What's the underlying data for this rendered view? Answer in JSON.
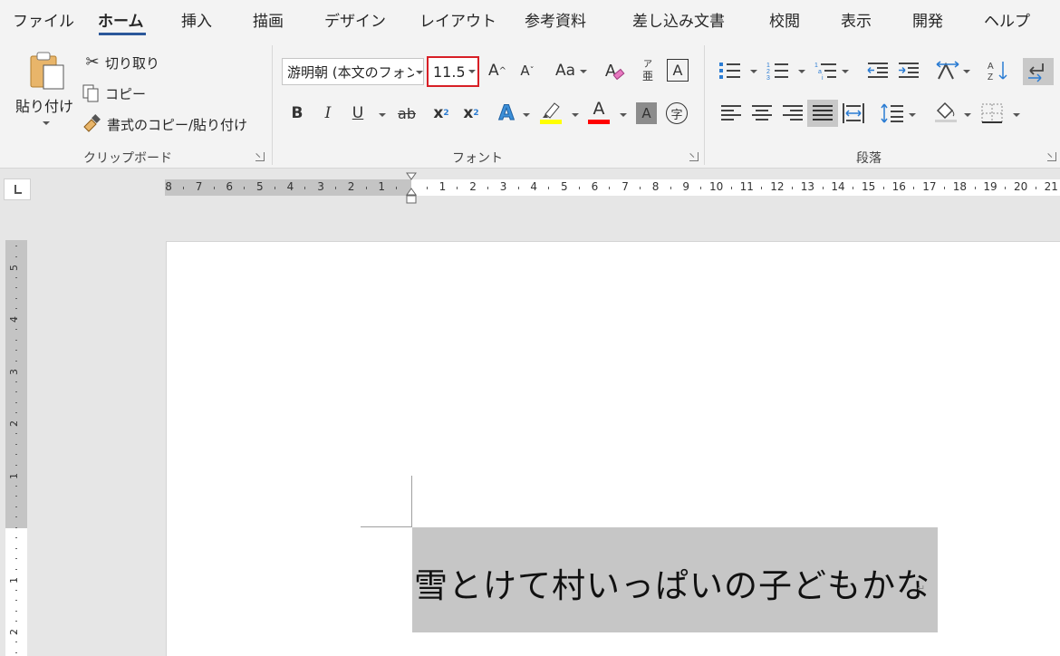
{
  "tabs": [
    {
      "label": "ファイル",
      "active": false
    },
    {
      "label": "ホーム",
      "active": true
    },
    {
      "label": "挿入",
      "active": false
    },
    {
      "label": "描画",
      "active": false
    },
    {
      "label": "デザイン",
      "active": false
    },
    {
      "label": "レイアウト",
      "active": false
    },
    {
      "label": "参考資料",
      "active": false
    },
    {
      "label": "差し込み文書",
      "active": false
    },
    {
      "label": "校閲",
      "active": false
    },
    {
      "label": "表示",
      "active": false
    },
    {
      "label": "開発",
      "active": false
    },
    {
      "label": "ヘルプ",
      "active": false
    }
  ],
  "clipboard": {
    "paste_label": "貼り付け",
    "cut_label": "切り取り",
    "copy_label": "コピー",
    "format_painter_label": "書式のコピー/貼り付け",
    "group_label": "クリップボード"
  },
  "font": {
    "name": "游明朝 (本文のフォント - 日本語)",
    "size": "11.5",
    "group_label": "フォント",
    "grow_icon_text": "A",
    "shrink_icon_text": "A",
    "case_icon_text": "Aa",
    "bold": "B",
    "italic": "I",
    "underline": "U",
    "strike": "ab",
    "subscript": "x",
    "subscript_mark": "2",
    "superscript": "x",
    "superscript_mark": "2",
    "text_effect": "A",
    "font_color_letter": "A",
    "char_shading_letter": "A",
    "enclose_char": "字",
    "phonetic_top": "ア",
    "phonetic_bottom": "亜",
    "char_border": "A",
    "highlight_color": "#ffff00",
    "font_color": "#ff0000"
  },
  "paragraph": {
    "group_label": "段落"
  },
  "ruler": {
    "horizontal_left_numbers": [
      "8",
      "7",
      "6",
      "5",
      "4",
      "3",
      "2",
      "1"
    ],
    "horizontal_right_numbers": [
      "1",
      "2",
      "3",
      "4",
      "5",
      "6",
      "7",
      "8",
      "9",
      "10",
      "11",
      "12",
      "13",
      "14",
      "15",
      "16",
      "17",
      "18",
      "19",
      "20",
      "21"
    ],
    "vertical_upper_numbers": [
      "5",
      "4",
      "3",
      "2",
      "1"
    ],
    "vertical_lower_numbers": [
      "1",
      "2"
    ]
  },
  "document": {
    "text": "雪とけて村いっぱいの子どもかな",
    "paragraph_mark": "↵"
  },
  "colors": {
    "accent": "#2b579a",
    "highlight_box": "#d81f26",
    "selection": "#c6c6c6"
  }
}
